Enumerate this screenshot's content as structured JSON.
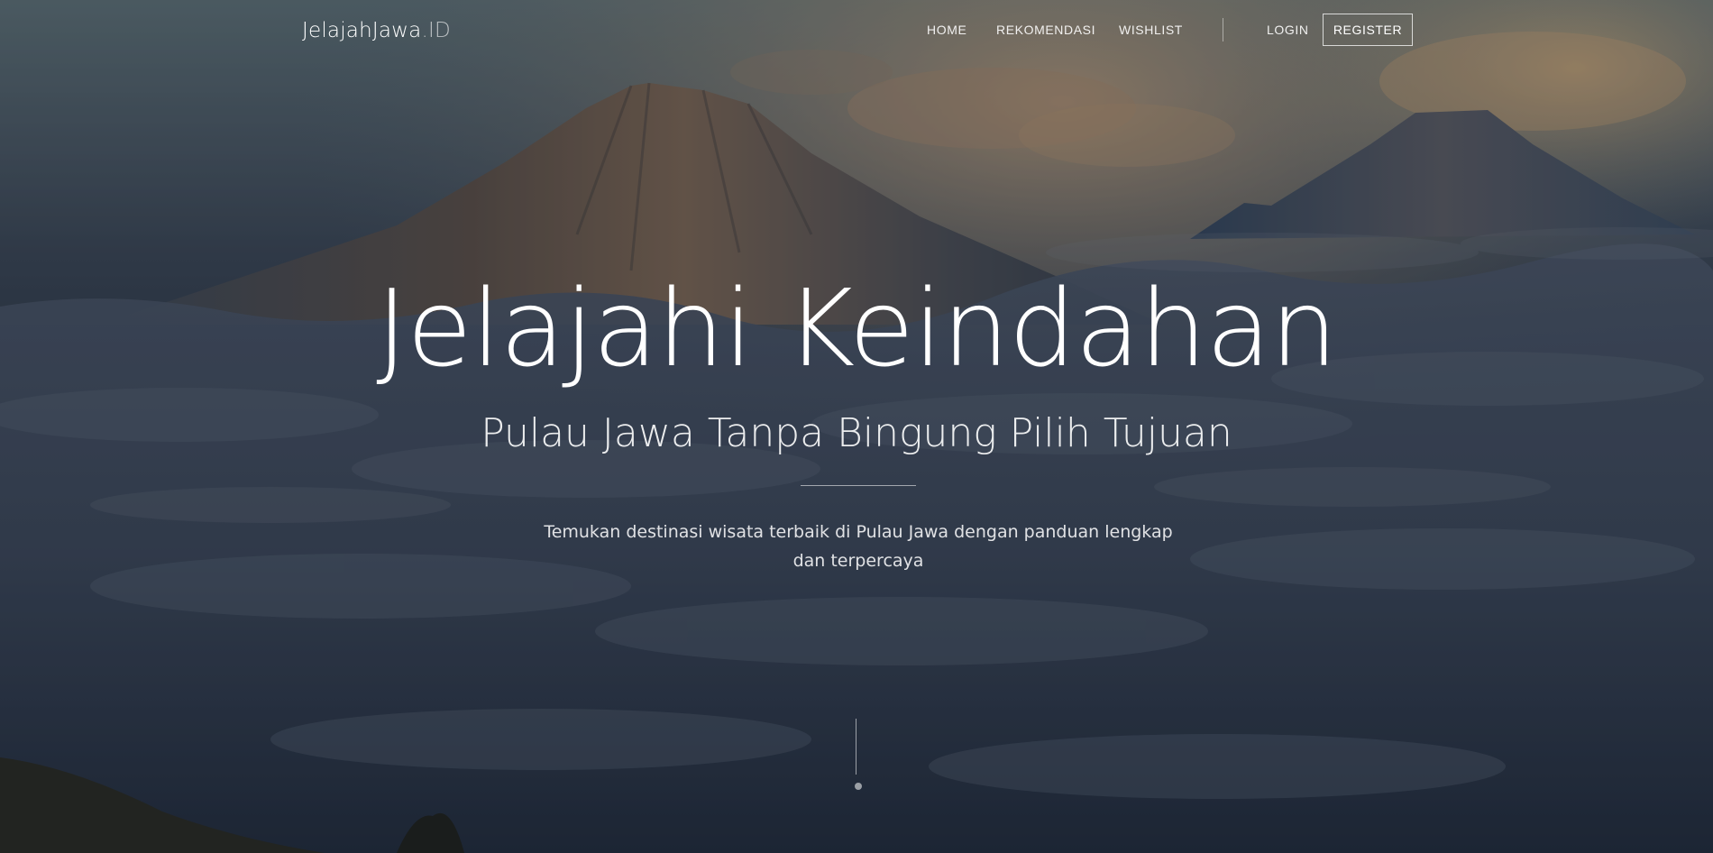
{
  "brand": {
    "name": "JelajahJawa",
    "suffix": ".ID"
  },
  "nav": {
    "items": [
      {
        "label": "HOME"
      },
      {
        "label": "REKOMENDASI"
      },
      {
        "label": "WISHLIST"
      }
    ],
    "login_label": "LOGIN",
    "register_label": "REGISTER"
  },
  "hero": {
    "title": "Jelajahi Keindahan",
    "subtitle": "Pulau Jawa Tanpa Bingung Pilih Tujuan",
    "description": "Temukan destinasi wisata terbaik di Pulau Jawa dengan panduan lengkap dan terpercaya"
  },
  "background": {
    "description_icon": "mountain-sea-of-clouds-photo",
    "colors": {
      "sky_top": "#5d6e73",
      "sunset_glow": "#c9a27a",
      "mountain_main": "#6b5a4d",
      "mountain_shadow": "#2c3644",
      "clouds": "#4a5566",
      "deep_bottom": "#1e2634"
    }
  }
}
